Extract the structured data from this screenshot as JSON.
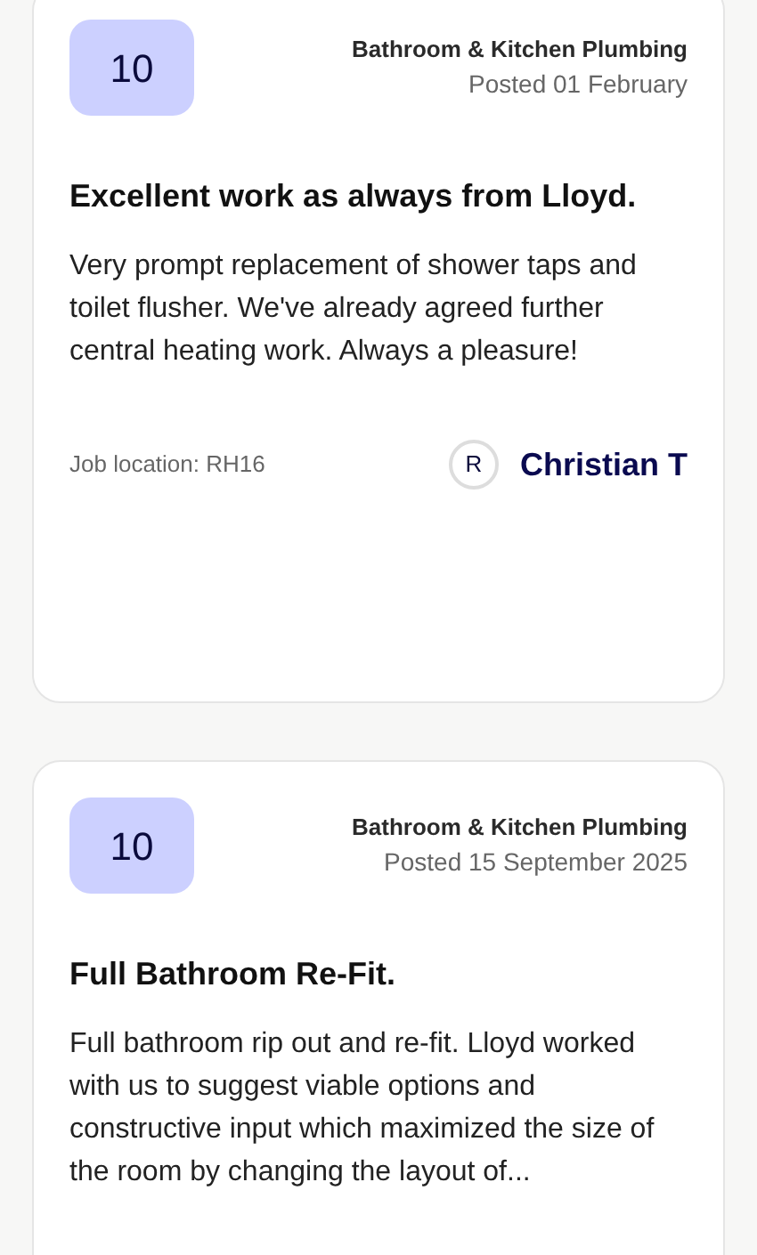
{
  "reviews": [
    {
      "score": "10",
      "category": "Bathroom & Kitchen Plumbing",
      "posted": "Posted 01 February",
      "title": "Excellent work as always from Lloyd.",
      "body": "Very prompt replacement of shower taps and toilet flusher. We've already agreed further central heating work. Always a pleasure!",
      "location": "Job location: RH16",
      "reviewer": {
        "initial": "R",
        "name": "Christian T"
      }
    },
    {
      "score": "10",
      "category": "Bathroom & Kitchen Plumbing",
      "posted": "Posted 15 September 2025",
      "title": "Full Bathroom Re-Fit.",
      "body": "Full bathroom rip out and re-fit. Lloyd worked with us to suggest viable options and constructive input which maximized the size of the room by changing the layout of..."
    }
  ]
}
